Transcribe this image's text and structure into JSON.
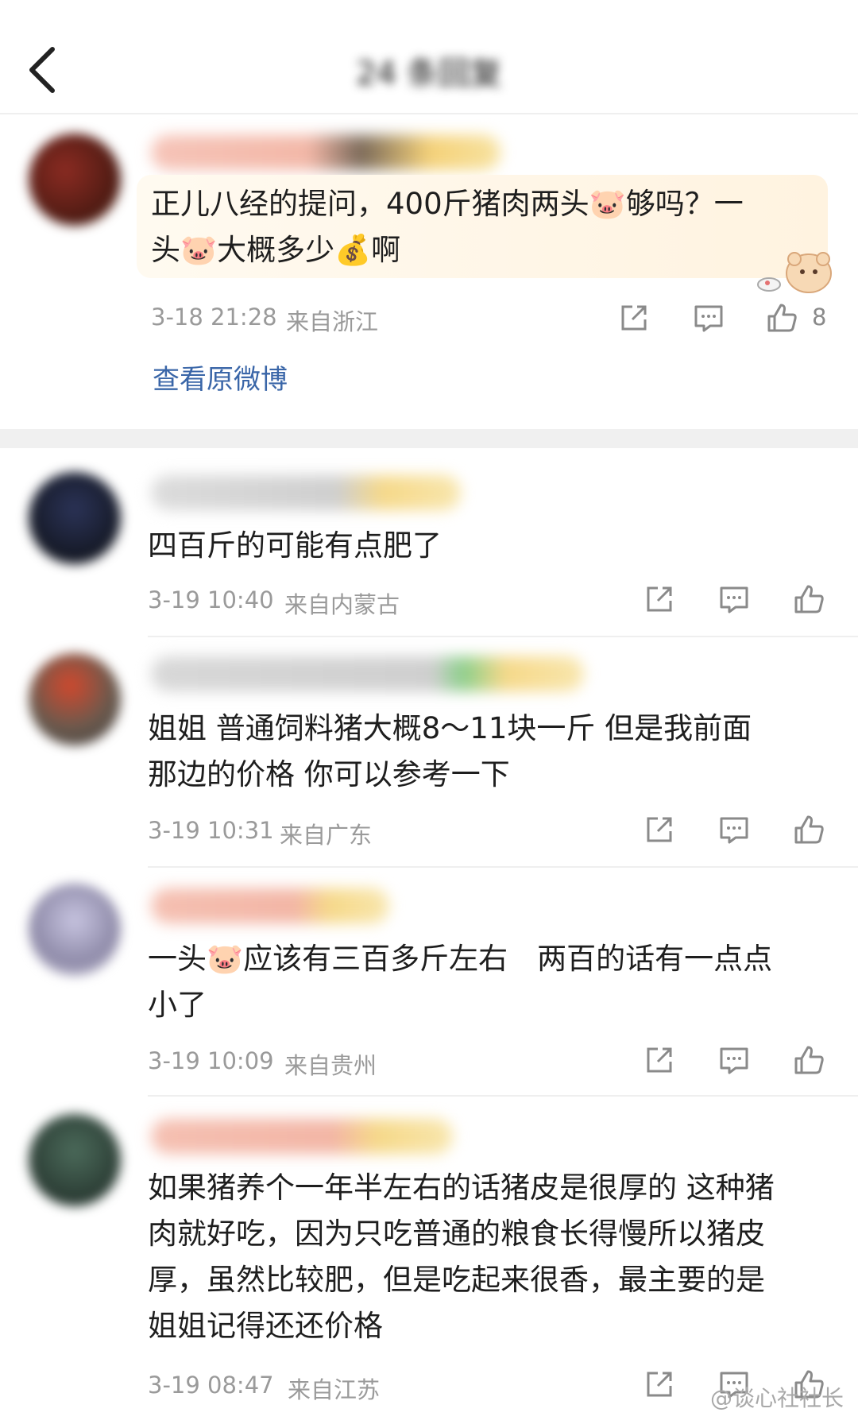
{
  "header": {
    "title": "24 条回复",
    "back_label": "back"
  },
  "main_comment": {
    "text_line1": "正儿八经的提问，400斤猪肉两头🐷够吗？一",
    "text_line2": "头🐷大概多少💰啊",
    "time": "3-18 21:28",
    "location": "来自浙江",
    "like_count": "8",
    "view_original": "查看原微博"
  },
  "replies": [
    {
      "lines": [
        "四百斤的可能有点肥了"
      ],
      "time": "3-19 10:40",
      "location": "来自内蒙古"
    },
    {
      "lines": [
        "姐姐 普通饲料猪大概8～11块一斤 但是我前面",
        "那边的价格 你可以参考一下"
      ],
      "time": "3-19 10:31",
      "location": "来自广东"
    },
    {
      "lines": [
        "一头🐷应该有三百多斤左右　两百的话有一点点",
        "小了"
      ],
      "time": "3-19 10:09",
      "location": "来自贵州"
    },
    {
      "lines": [
        "如果猪养个一年半左右的话猪皮是很厚的 这种猪",
        "肉就好吃，因为只吃普通的粮食长得慢所以猪皮",
        "厚，虽然比较肥，但是吃起来很香，最主要的是",
        "姐姐记得还还价格"
      ],
      "time": "3-19 08:47",
      "location": "来自江苏"
    }
  ],
  "icons": {
    "share": "share-icon",
    "comment": "comment-icon",
    "like": "thumbs-up-icon"
  },
  "watermark": "@谈心社社长",
  "colors": {
    "link": "#3a66a8",
    "meta": "#9a9a9a",
    "highlight": "#fff3e0"
  }
}
